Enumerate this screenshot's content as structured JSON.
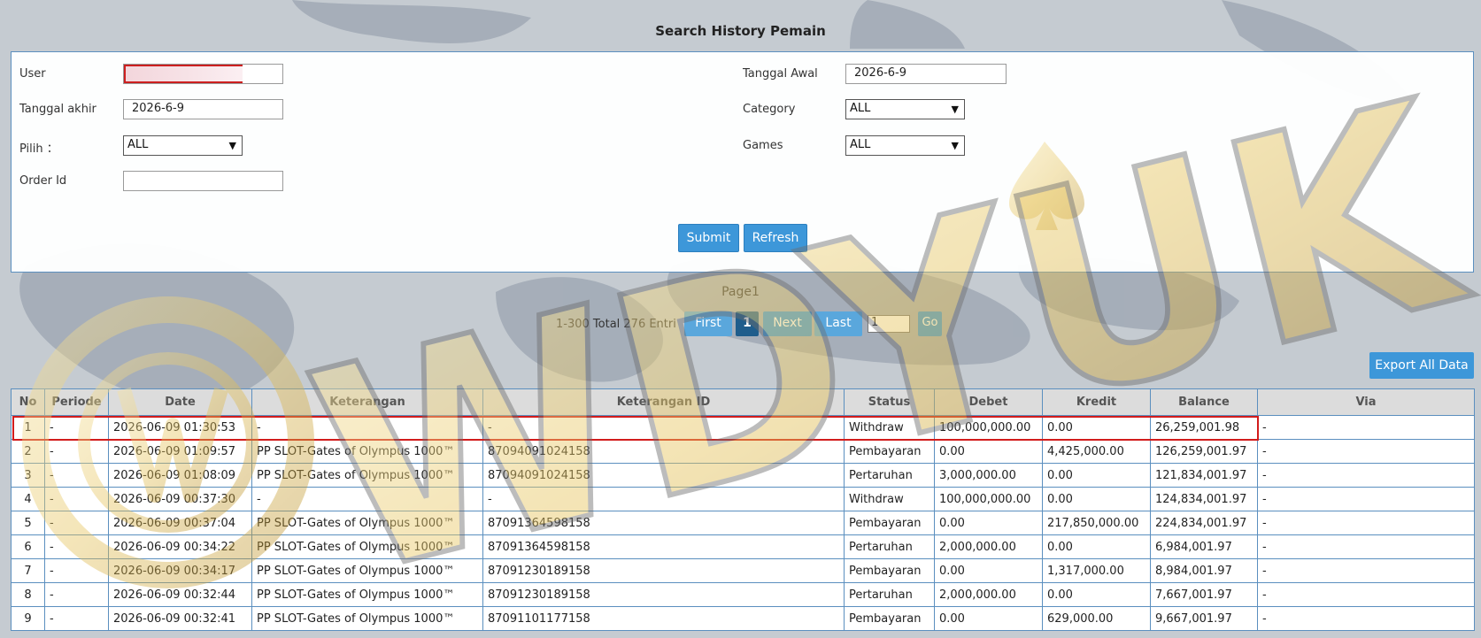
{
  "page": {
    "title": "Search History Pemain"
  },
  "form": {
    "user_label": "User",
    "user_value": "",
    "tanggal_akhir_label": "Tanggal akhir",
    "tanggal_akhir_value": "2026-6-9",
    "pilih_label": "Pilih ：",
    "pilih_value": "ALL",
    "order_id_label": "Order Id",
    "order_id_value": "",
    "tanggal_awal_label": "Tanggal Awal",
    "tanggal_awal_value": "2026-6-9",
    "category_label": "Category",
    "category_value": "ALL",
    "games_label": "Games",
    "games_value": "ALL",
    "submit_label": "Submit",
    "refresh_label": "Refresh"
  },
  "pagination": {
    "page_label": "Page1",
    "entries_text": "1-300 Total 276 Entri",
    "first": "First",
    "current": "1",
    "next": "Next",
    "last": "Last",
    "page_input": "1",
    "go": "Go"
  },
  "export_label": "Export All Data",
  "watermark": "WDYUK",
  "table": {
    "headers": [
      "No",
      "Periode",
      "Date",
      "Keterangan",
      "Keterangan ID",
      "Status",
      "Debet",
      "Kredit",
      "Balance",
      "Via"
    ],
    "rows": [
      {
        "no": "1",
        "periode": "-",
        "date": "2026-06-09 01:30:53",
        "ket": "-",
        "ket_id": "-",
        "status": "Withdraw",
        "debet": "100,000,000.00",
        "kredit": "0.00",
        "balance": "26,259,001.98",
        "via": "-"
      },
      {
        "no": "2",
        "periode": "-",
        "date": "2026-06-09 01:09:57",
        "ket": "PP SLOT-Gates of Olympus 1000™",
        "ket_id": "87094091024158",
        "status": "Pembayaran",
        "debet": "0.00",
        "kredit": "4,425,000.00",
        "balance": "126,259,001.97",
        "via": "-"
      },
      {
        "no": "3",
        "periode": "-",
        "date": "2026-06-09 01:08:09",
        "ket": "PP SLOT-Gates of Olympus 1000™",
        "ket_id": "87094091024158",
        "status": "Pertaruhan",
        "debet": "3,000,000.00",
        "kredit": "0.00",
        "balance": "121,834,001.97",
        "via": "-"
      },
      {
        "no": "4",
        "periode": "-",
        "date": "2026-06-09 00:37:30",
        "ket": "-",
        "ket_id": "-",
        "status": "Withdraw",
        "debet": "100,000,000.00",
        "kredit": "0.00",
        "balance": "124,834,001.97",
        "via": "-"
      },
      {
        "no": "5",
        "periode": "-",
        "date": "2026-06-09 00:37:04",
        "ket": "PP SLOT-Gates of Olympus 1000™",
        "ket_id": "87091364598158",
        "status": "Pembayaran",
        "debet": "0.00",
        "kredit": "217,850,000.00",
        "balance": "224,834,001.97",
        "via": "-"
      },
      {
        "no": "6",
        "periode": "-",
        "date": "2026-06-09 00:34:22",
        "ket": "PP SLOT-Gates of Olympus 1000™",
        "ket_id": "87091364598158",
        "status": "Pertaruhan",
        "debet": "2,000,000.00",
        "kredit": "0.00",
        "balance": "6,984,001.97",
        "via": "-"
      },
      {
        "no": "7",
        "periode": "-",
        "date": "2026-06-09 00:34:17",
        "ket": "PP SLOT-Gates of Olympus 1000™",
        "ket_id": "87091230189158",
        "status": "Pembayaran",
        "debet": "0.00",
        "kredit": "1,317,000.00",
        "balance": "8,984,001.97",
        "via": "-"
      },
      {
        "no": "8",
        "periode": "-",
        "date": "2026-06-09 00:32:44",
        "ket": "PP SLOT-Gates of Olympus 1000™",
        "ket_id": "87091230189158",
        "status": "Pertaruhan",
        "debet": "2,000,000.00",
        "kredit": "0.00",
        "balance": "7,667,001.97",
        "via": "-"
      },
      {
        "no": "9",
        "periode": "-",
        "date": "2026-06-09 00:32:41",
        "ket": "PP SLOT-Gates of Olympus 1000™",
        "ket_id": "87091101177158",
        "status": "Pembayaran",
        "debet": "0.00",
        "kredit": "629,000.00",
        "balance": "9,667,001.97",
        "via": "-"
      }
    ]
  },
  "colors": {
    "accent": "#3d97d9",
    "highlight_border": "#d21c1c",
    "withdraw_red": "#cc1f1f",
    "link": "#3d8fc6"
  }
}
